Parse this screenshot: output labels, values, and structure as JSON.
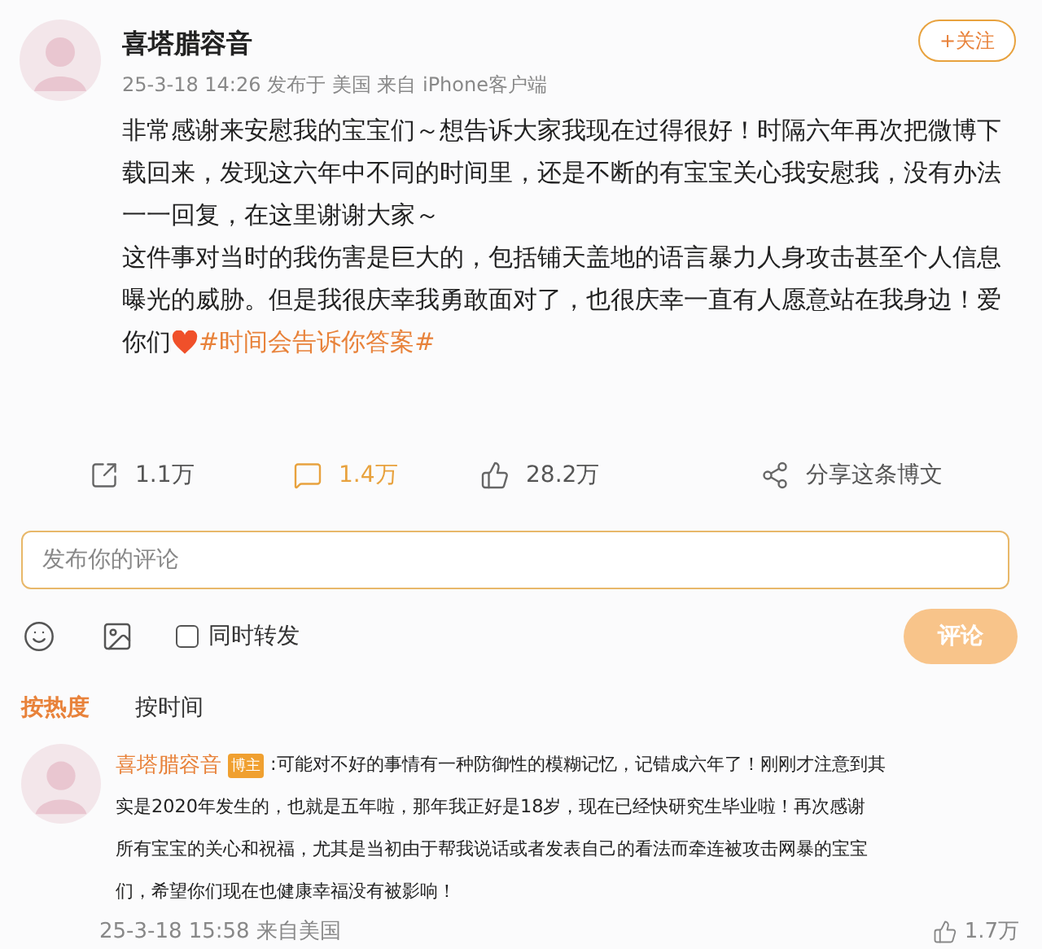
{
  "post": {
    "author": "喜塔腊容音",
    "follow_label": "+关注",
    "meta": "25-3-18 14:26 发布于 美国 来自 iPhone客户端",
    "lines": [
      "非常感谢来安慰我的宝宝们～想告诉大家我现在过得很好！时隔六年再次把微博下",
      "载回来，发现这六年中不同的时间里，还是不断的有宝宝关心我安慰我，没有办法",
      "一一回复，在这里谢谢大家～",
      "这件事对当时的我伤害是巨大的，包括铺天盖地的语言暴力人身攻击甚至个人信息",
      "曝光的威胁。但是我很庆幸我勇敢面对了，也很庆幸一直有人愿意站在我身边！爱"
    ],
    "last_line": {
      "text": "你们",
      "hashtag": "#时间会告诉你答案#"
    }
  },
  "actions": [
    {
      "kind": "repost",
      "label": "1.1万",
      "selected": false
    },
    {
      "kind": "comment",
      "label": "1.4万",
      "selected": true
    },
    {
      "kind": "like",
      "label": "28.2万",
      "selected": false
    },
    {
      "kind": "share",
      "label": "分享这条博文",
      "selected": false
    }
  ],
  "comment_box": {
    "placeholder": "发布你的评论",
    "repost_label": "同时转发",
    "repost_checked": false,
    "submit_label": "评论"
  },
  "sort_tabs": [
    {
      "label": "按热度",
      "selected": true
    },
    {
      "label": "按时间",
      "selected": false
    }
  ],
  "comments": [
    {
      "author": "喜塔腊容音",
      "badge": "博主",
      "lines": [
        ":可能对不好的事情有一种防御性的模糊记忆，记错成六年了！刚刚才注意到其",
        "实是2020年发生的，也就是五年啦，那年我正好是18岁，现在已经快研究生毕业啦！再次感谢",
        "所有宝宝的关心和祝福，尤其是当初由于帮我说话或者发表自己的看法而牵连被攻击网暴的宝宝",
        "们，希望你们现在也健康幸福没有被影响！"
      ],
      "time": "25-3-18 15:58 来自美国",
      "likes": "1.7万"
    }
  ]
}
